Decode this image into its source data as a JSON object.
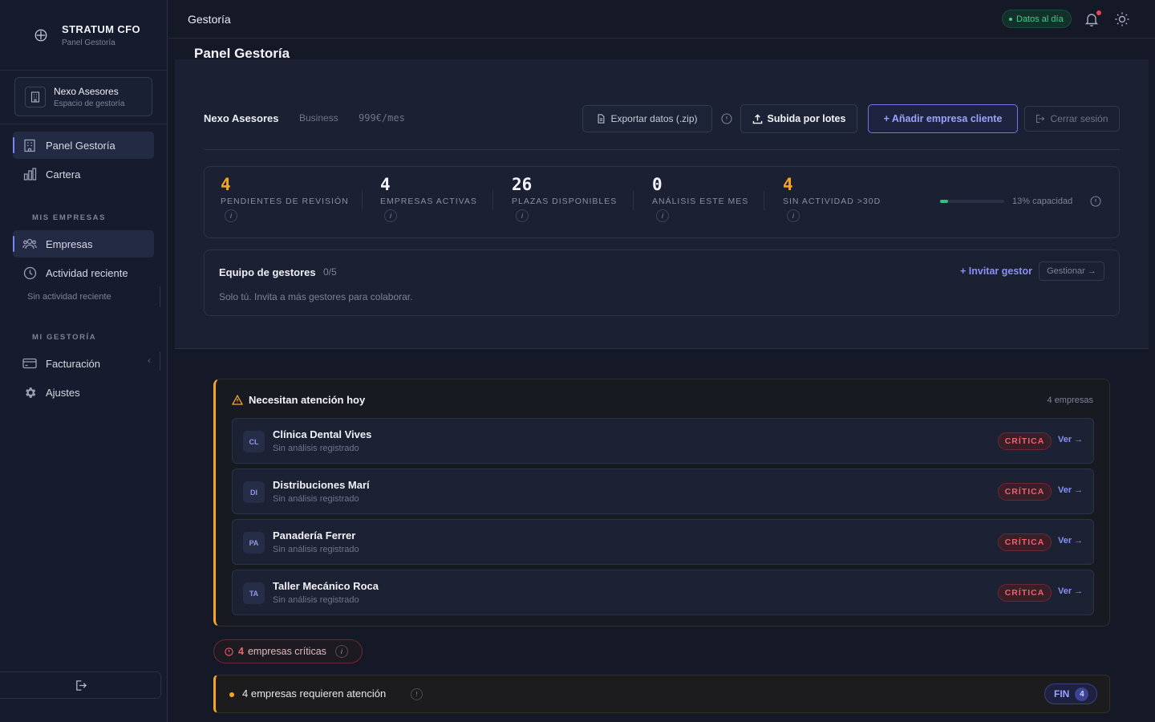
{
  "sidebar": {
    "brand_title": "STRATUM CFO",
    "brand_sub": "Panel Gestoría",
    "workspace_name": "Nexo Asesores",
    "workspace_sub": "Espacio de gestoría",
    "nav_panel": "Panel Gestoría",
    "nav_cartera": "Cartera",
    "section_empresas": "MIS EMPRESAS",
    "nav_empresas": "Empresas",
    "nav_actividad": "Actividad reciente",
    "actividad_empty": "Sin actividad reciente",
    "section_gestoria": "MI GESTORÍA",
    "nav_facturacion": "Facturación",
    "nav_ajustes": "Ajustes"
  },
  "header": {
    "title": "Gestoría",
    "status": "Datos al día"
  },
  "main": {
    "page_title": "Panel Gestoría",
    "org_name": "Nexo Asesores",
    "org_plan": "Business",
    "org_price": "999€/mes",
    "export_label": "Exportar datos (.zip)",
    "upload_label": "Subida por lotes",
    "add_label": "+ Añadir empresa cliente",
    "close_label": "Cerrar sesión",
    "stats": [
      {
        "value": "4",
        "label": "PENDIENTES DE REVISIÓN",
        "accent": "#f5a524"
      },
      {
        "value": "4",
        "label": "EMPRESAS ACTIVAS"
      },
      {
        "value": "26",
        "label": "PLAZAS DISPONIBLES"
      },
      {
        "value": "0",
        "label": "ANÁLISIS ESTE MES"
      },
      {
        "value": "4",
        "label": "SIN ACTIVIDAD >30D",
        "accent": "#f5a524"
      }
    ],
    "capacity_percent": 13,
    "capacity_label": "13% capacidad",
    "team_title": "Equipo de gestores",
    "team_count": "0/5",
    "team_desc": "Solo tú. Invita a más gestores para colaborar.",
    "team_invite": "+ Invitar gestor",
    "team_manage": "Gestionar →"
  },
  "attention": {
    "title": "Necesitan atención hoy",
    "count": "4 empresas",
    "rows": [
      {
        "initials": "CL",
        "name": "Clínica Dental Vives",
        "sub": "Sin análisis registrado",
        "badge": "CRÍTICA",
        "action": "Ver →"
      },
      {
        "initials": "DI",
        "name": "Distribuciones Marí",
        "sub": "Sin análisis registrado",
        "badge": "CRÍTICA",
        "action": "Ver →"
      },
      {
        "initials": "PA",
        "name": "Panadería Ferrer",
        "sub": "Sin análisis registrado",
        "badge": "CRÍTICA",
        "action": "Ver →"
      },
      {
        "initials": "TA",
        "name": "Taller Mecánico Roca",
        "sub": "Sin análisis registrado",
        "badge": "CRÍTICA",
        "action": "Ver →"
      }
    ]
  },
  "critical_pill": {
    "count": "4",
    "label": "empresas críticas"
  },
  "warning": {
    "text": "4 empresas requieren atención",
    "fin_label": "FIN",
    "fin_count": "4"
  },
  "colors": {
    "accent": "#7b86f5",
    "warning": "#f5a524",
    "critical": "#f0606e",
    "success": "#3ccf8e"
  }
}
